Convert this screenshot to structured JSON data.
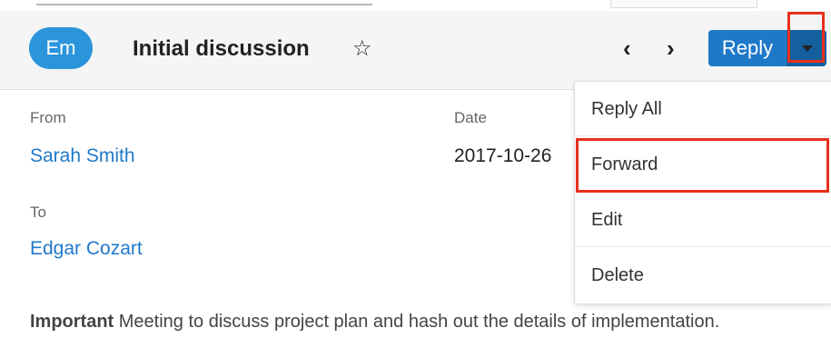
{
  "header": {
    "avatar_initials": "Em",
    "title": "Initial discussion",
    "star_icon": "☆",
    "prev_icon": "‹",
    "next_icon": "›",
    "reply_label": "Reply"
  },
  "fields": {
    "from_label": "From",
    "from_value": "Sarah Smith",
    "date_label": "Date",
    "date_value": "2017-10-26",
    "to_label": "To",
    "to_value": "Edgar Cozart"
  },
  "body": {
    "bold_word": "Important",
    "text": " Meeting to discuss project plan and hash out the details of implementation."
  },
  "menu": {
    "items": [
      "Reply All",
      "Forward",
      "Edit",
      "Delete"
    ]
  },
  "colors": {
    "accent": "#1f79c9",
    "accent_dark": "#145f9e",
    "avatar": "#2b95dc",
    "highlight": "#e8301c"
  }
}
